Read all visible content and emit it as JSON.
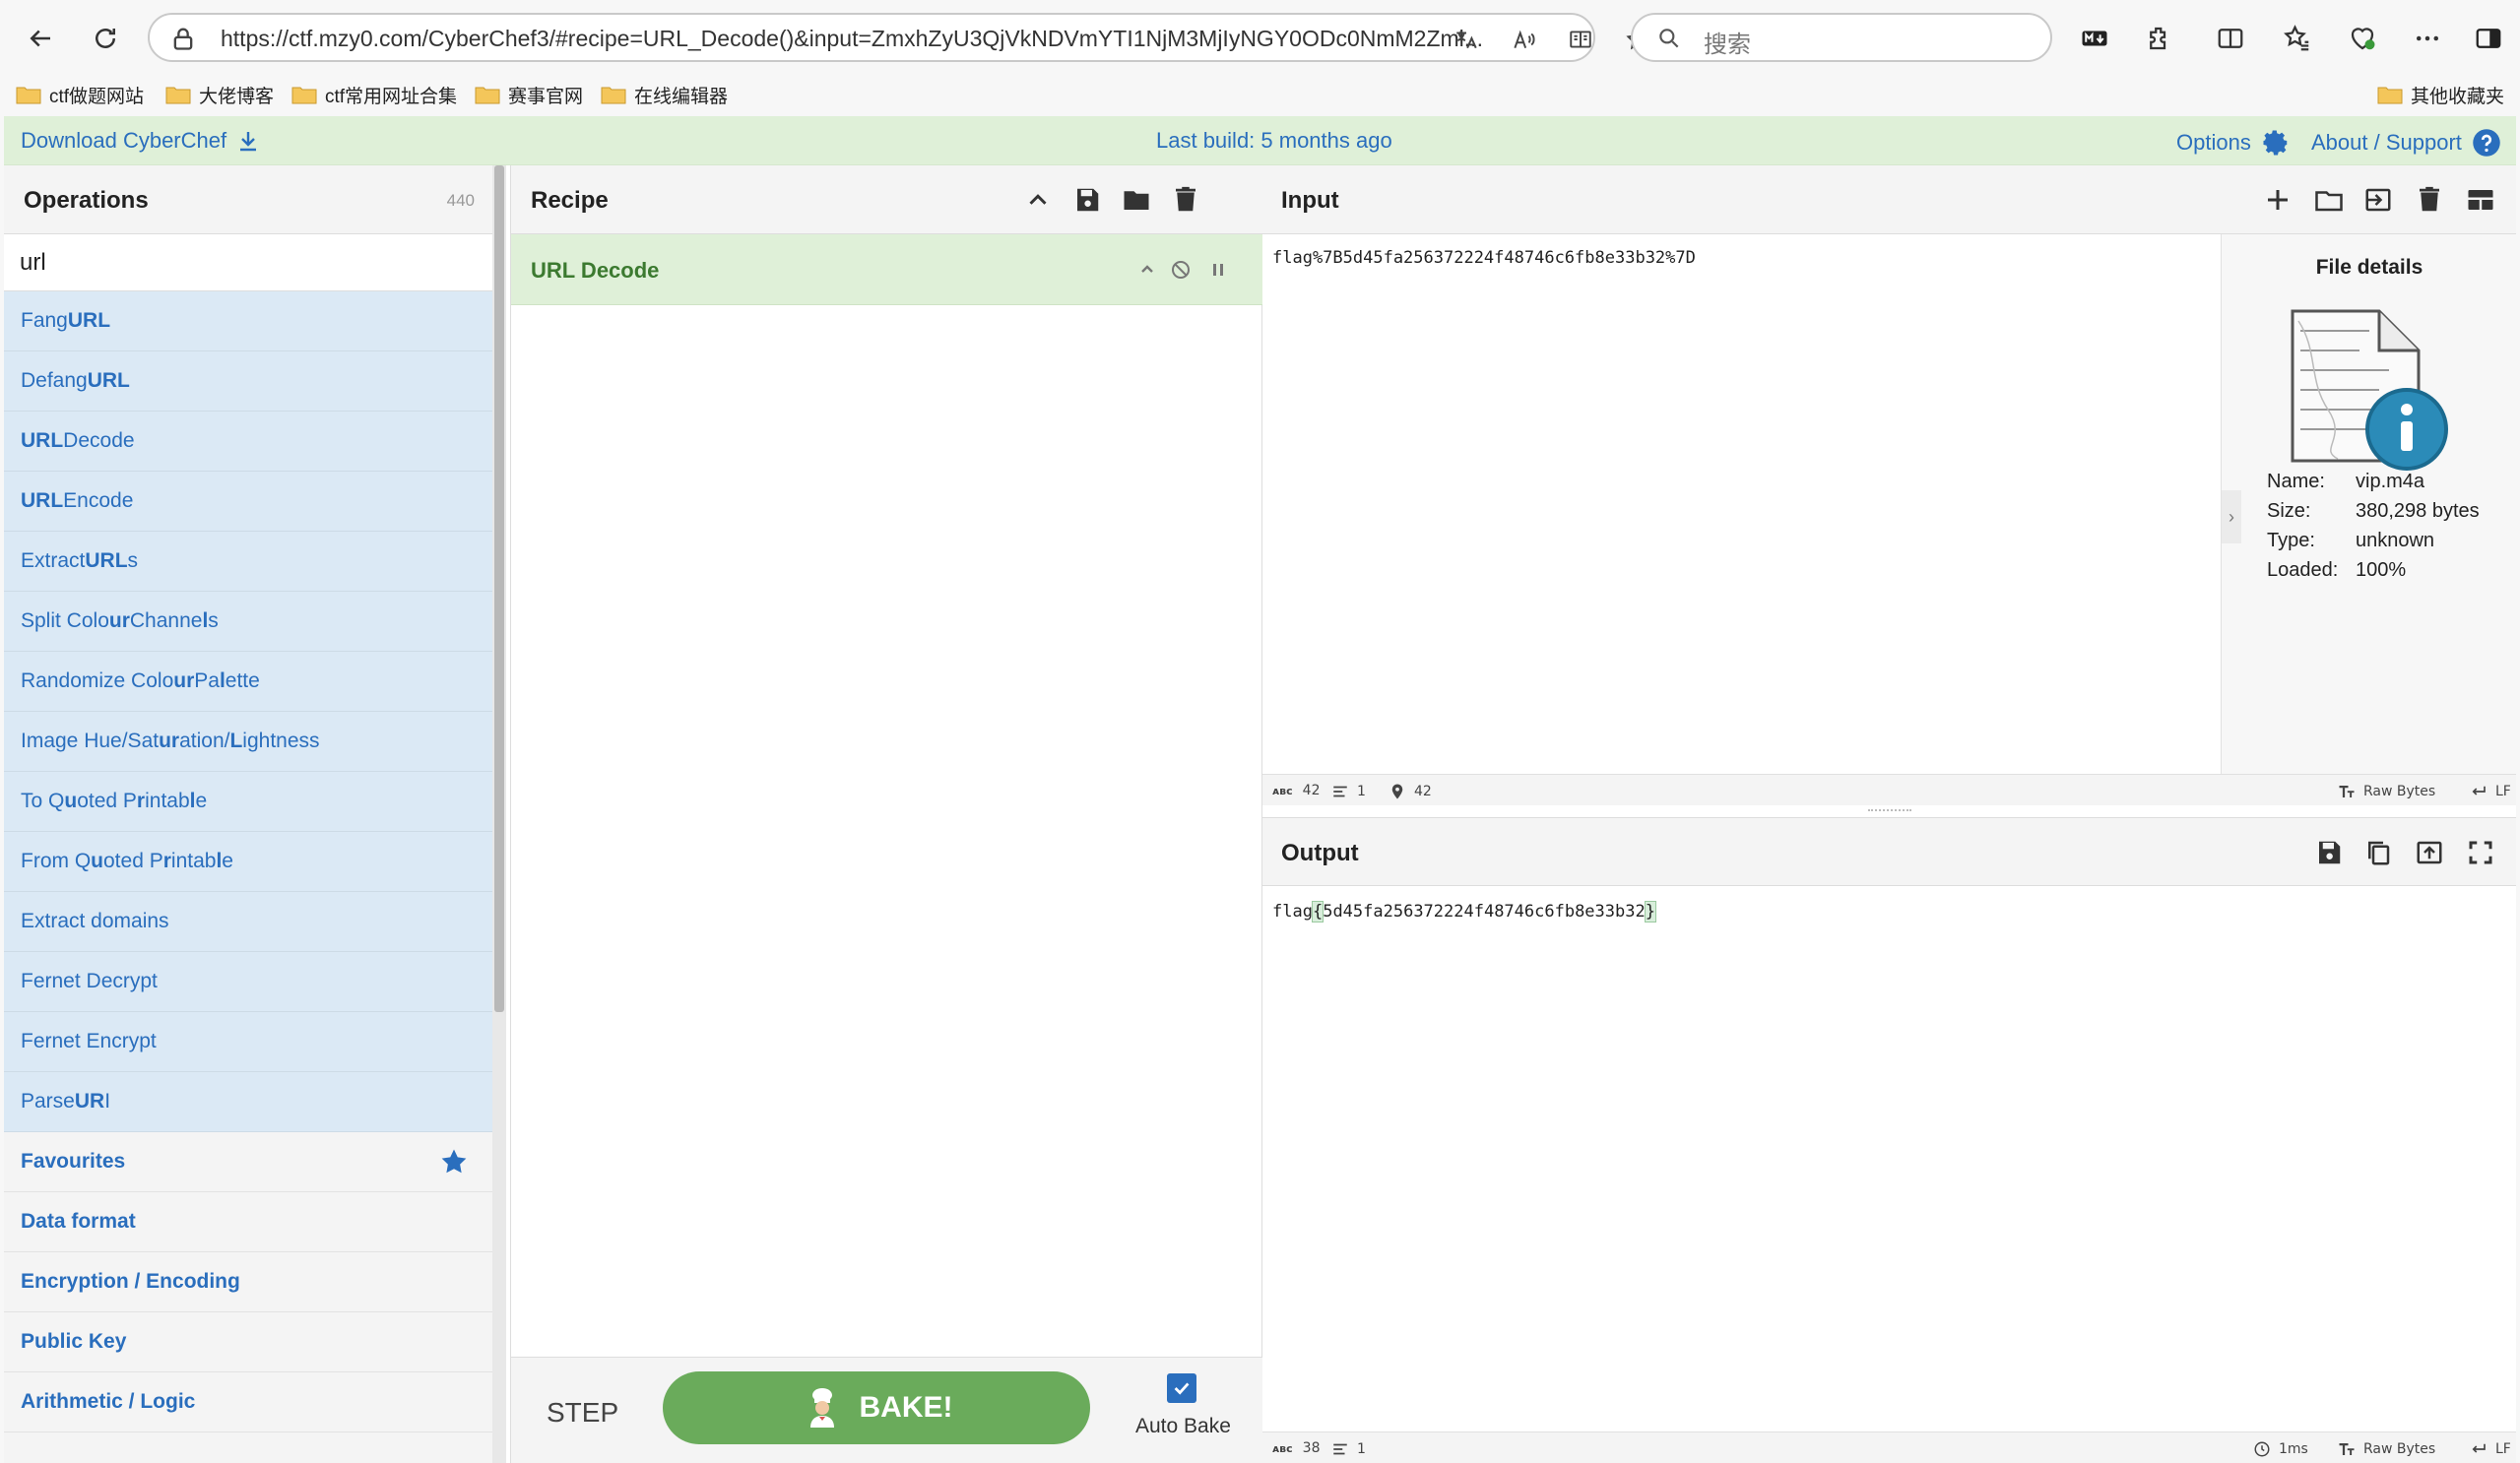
{
  "browser": {
    "url": "https://ctf.mzy0.com/CyberChef3/#recipe=URL_Decode()&input=ZmxhZyU3QjVkNDVmYTI1NjM3MjIyNGY0ODc0NmM2Zml...",
    "search_placeholder": "搜索",
    "bookmarks": [
      "ctf做题网站",
      "大佬博客",
      "ctf常用网址合集",
      "赛事官网",
      "在线编辑器"
    ],
    "other_bookmarks": "其他收藏夹"
  },
  "banner": {
    "download": "Download CyberChef",
    "last_build": "Last build: 5 months ago",
    "options": "Options",
    "about": "About / Support"
  },
  "operations": {
    "title": "Operations",
    "count": "440",
    "search_value": "url",
    "results": [
      {
        "pre": "Fang ",
        "bold": "URL",
        "post": ""
      },
      {
        "pre": "Defang ",
        "bold": "URL",
        "post": ""
      },
      {
        "pre": "",
        "bold": "URL",
        "post": " Decode"
      },
      {
        "pre": "",
        "bold": "URL",
        "post": " Encode"
      },
      {
        "pre": "Extract ",
        "bold": "URL",
        "post": "s"
      },
      {
        "pre": "Split Colo",
        "bold": "ur",
        "post": " Channe",
        "bold2": "l",
        "post2": "s"
      },
      {
        "pre": "Randomize Colo",
        "bold": "ur",
        "post": " Pa",
        "bold2": "l",
        "post2": "ette"
      },
      {
        "pre": "Image Hue/Sat",
        "bold": "ur",
        "post": "ation/",
        "bold2": "L",
        "post2": "ightness"
      },
      {
        "pre": "To Q",
        "bold": "u",
        "post": "oted P",
        "bold2": "r",
        "post2": "intab",
        "bold3": "l",
        "post3": "e"
      },
      {
        "pre": "From Q",
        "bold": "u",
        "post": "oted P",
        "bold2": "r",
        "post2": "intab",
        "bold3": "l",
        "post3": "e"
      },
      {
        "pre": "Extract domains",
        "bold": "",
        "post": ""
      },
      {
        "pre": "Fernet Decrypt",
        "bold": "",
        "post": ""
      },
      {
        "pre": "Fernet Encrypt",
        "bold": "",
        "post": ""
      },
      {
        "pre": "Parse ",
        "bold": "UR",
        "post": "I"
      }
    ],
    "categories": [
      "Favourites",
      "Data format",
      "Encryption / Encoding",
      "Public Key",
      "Arithmetic / Logic"
    ]
  },
  "recipe": {
    "title": "Recipe",
    "operation": "URL Decode",
    "step_label": "STEP",
    "bake_label": "BAKE!",
    "autobake_label": "Auto Bake",
    "autobake_checked": true
  },
  "input": {
    "title": "Input",
    "text": "flag%7B5d45fa256372224f48746c6fb8e33b32%7D",
    "status": {
      "length": "42",
      "lines": "1",
      "position": "42",
      "encoding": "Raw Bytes",
      "eol": "LF"
    }
  },
  "file_details": {
    "title": "File details",
    "rows": [
      {
        "key": "Name:",
        "value": "vip.m4a"
      },
      {
        "key": "Size:",
        "value": "380,298 bytes"
      },
      {
        "key": "Type:",
        "value": "unknown"
      },
      {
        "key": "Loaded:",
        "value": "100%"
      }
    ]
  },
  "output": {
    "title": "Output",
    "prefix": "flag",
    "open_brace": "{",
    "body": "5d45fa256372224f48746c6fb8e33b32",
    "close_brace": "}",
    "status": {
      "length": "38",
      "lines": "1",
      "time": "1ms",
      "encoding": "Raw Bytes",
      "eol": "LF"
    }
  },
  "colors": {
    "accent_blue": "#2a6ebd",
    "banner_green": "#dff0d8",
    "bake_green": "#6aab5b",
    "op_highlight": "#dbe9f5"
  }
}
